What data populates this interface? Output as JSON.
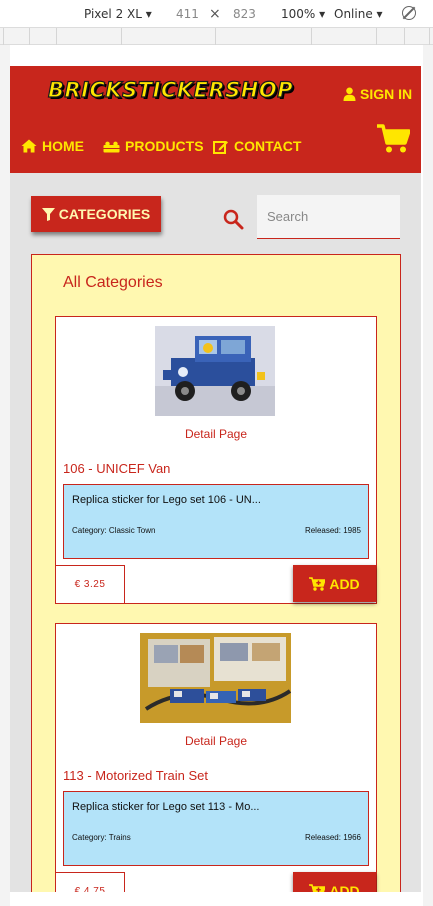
{
  "devtools": {
    "device": "Pixel 2 XL",
    "width": "411",
    "height": "823",
    "zoom": "100%",
    "network": "Online"
  },
  "navbar": {
    "logo_text": "BRICKSTICKERSHOP",
    "signin_label": "SIGN IN",
    "links": [
      {
        "label": "HOME",
        "icon": "home-icon"
      },
      {
        "label": "PRODUCTS",
        "icon": "products-icon"
      },
      {
        "label": "CONTACT",
        "icon": "edit-icon"
      }
    ],
    "cart_icon": "shopping-cart-icon"
  },
  "controls": {
    "categories_label": "CATEGORIES",
    "search_placeholder": "Search"
  },
  "panel": {
    "title": "All Categories"
  },
  "products": [
    {
      "detail_label": "Detail Page",
      "title": "106 - UNICEF Van",
      "description": "Replica sticker for Lego set 106 - UN...",
      "category": "Category: Classic Town",
      "released": "Released: 1985",
      "price": "€ 3.25",
      "add_label": "ADD"
    },
    {
      "detail_label": "Detail Page",
      "title": "113 - Motorized Train Set",
      "description": "Replica sticker for Lego set 113 - Mo...",
      "category": "Category: Trains",
      "released": "Released: 1966",
      "price": "€ 4.75",
      "add_label": "ADD"
    }
  ],
  "colors": {
    "brand_red": "#c8261c",
    "brand_yellow": "#ffe600",
    "panel_bg": "#fff8b0",
    "desc_bg": "#b3e3f9"
  }
}
